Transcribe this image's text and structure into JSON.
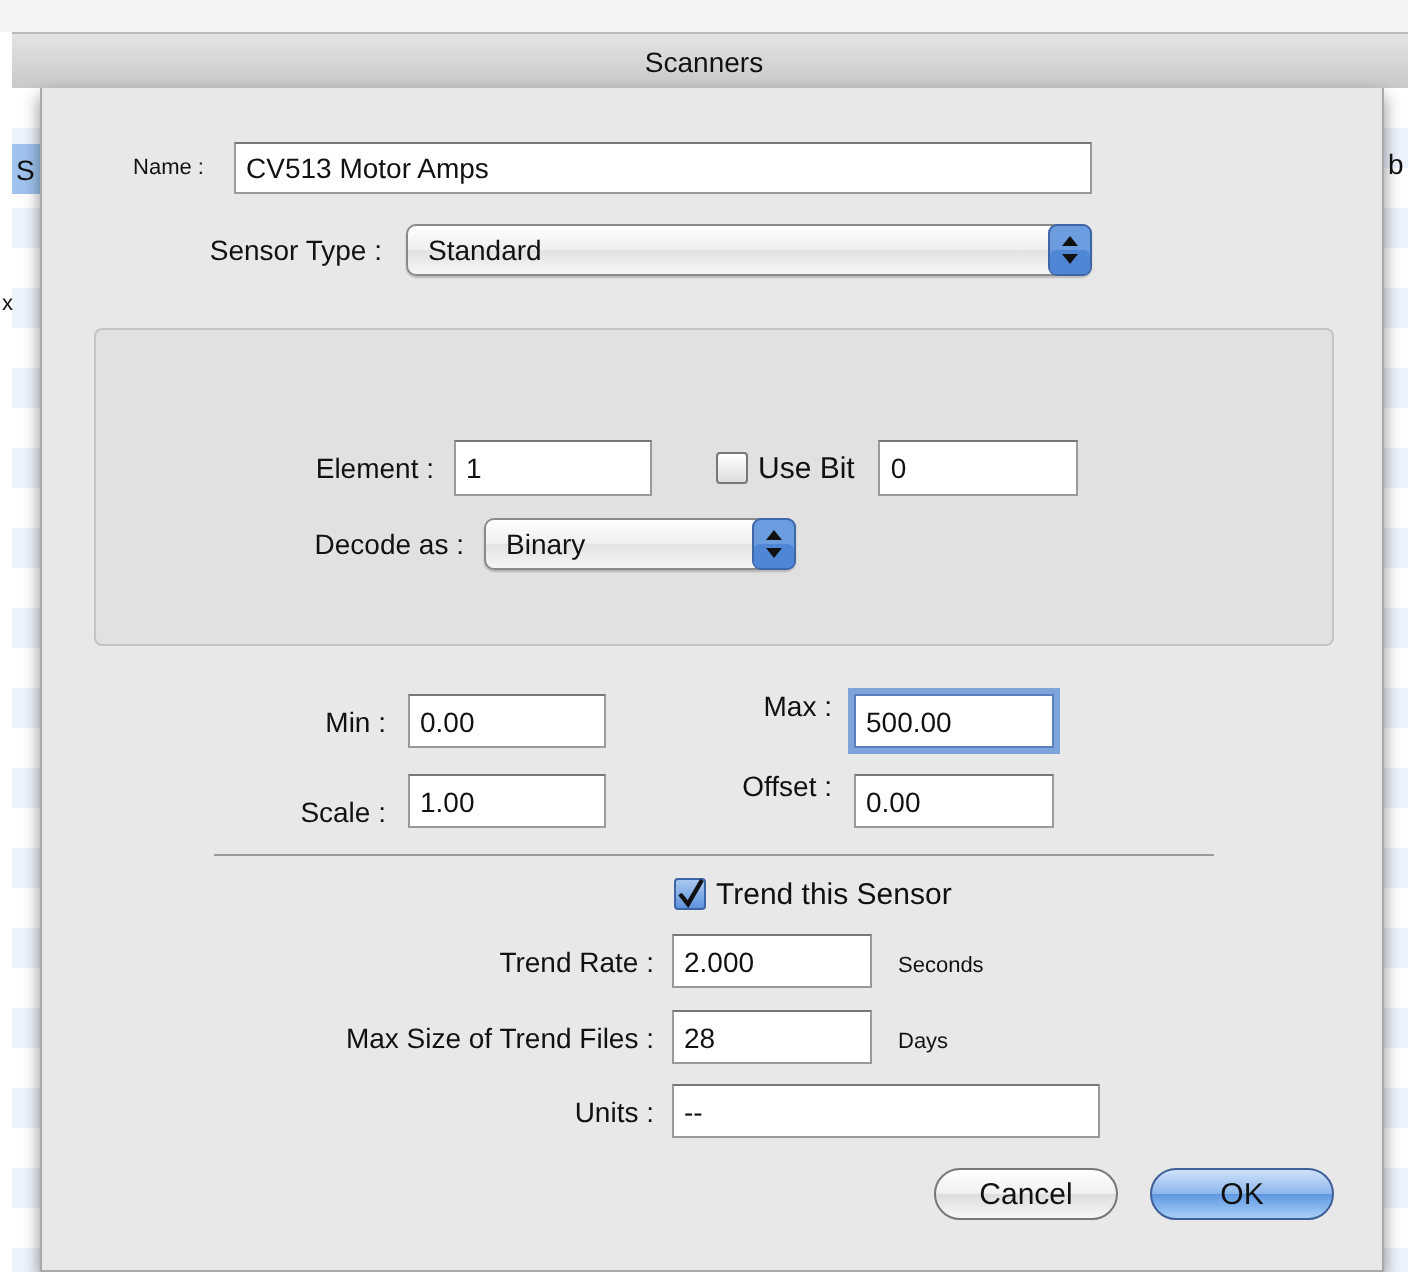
{
  "window": {
    "title": "Scanners"
  },
  "background_window": {
    "left_tab": "S",
    "right_tab": "b",
    "row_mark": "x"
  },
  "dialog": {
    "name": {
      "label": "Name :",
      "value": "CV513 Motor Amps",
      "focused": false
    },
    "sensor_type": {
      "label": "Sensor Type :",
      "value": "Standard"
    },
    "element": {
      "label": "Element :",
      "value": "1",
      "focused": false
    },
    "use_bit": {
      "label": "Use Bit",
      "checked": false,
      "value": "0",
      "focused": false
    },
    "decode_as": {
      "label": "Decode as :",
      "value": "Binary"
    },
    "min": {
      "label": "Min :",
      "value": "0.00",
      "focused": false
    },
    "max": {
      "label": "Max :",
      "value": "500.00",
      "focused": true
    },
    "scale": {
      "label": "Scale :",
      "value": "1.00",
      "focused": false
    },
    "offset": {
      "label": "Offset :",
      "value": "0.00",
      "focused": false
    },
    "trend": {
      "label": "Trend this Sensor",
      "checked": true
    },
    "trend_rate": {
      "label": "Trend Rate :",
      "value": "2.000",
      "unit": "Seconds",
      "focused": false
    },
    "max_size": {
      "label": "Max Size of Trend Files :",
      "value": "28",
      "unit": "Days",
      "focused": false
    },
    "units": {
      "label": "Units :",
      "value": "--",
      "focused": false
    },
    "buttons": [
      {
        "label": "Cancel",
        "default": false
      },
      {
        "label": "OK",
        "default": true
      }
    ]
  }
}
